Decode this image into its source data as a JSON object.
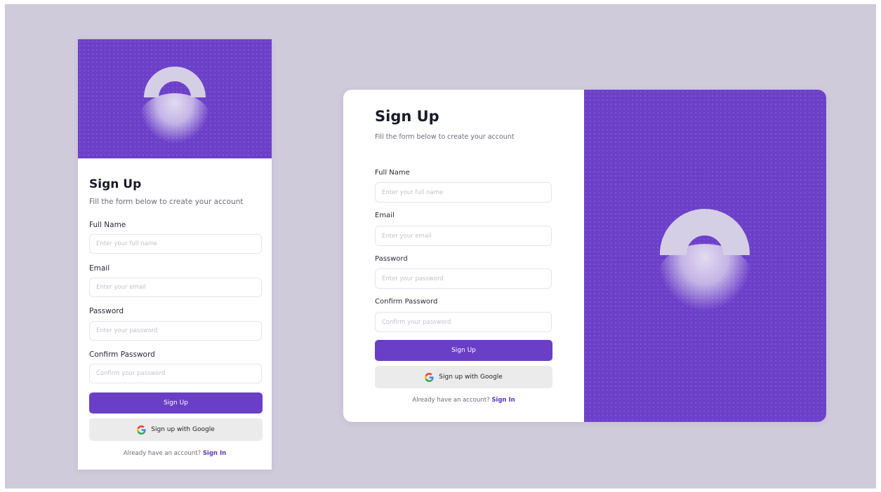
{
  "form": {
    "title": "Sign Up",
    "subtitle": "Fill the form below to create your account",
    "fields": [
      {
        "label": "Full Name",
        "placeholder": "Enter your full name"
      },
      {
        "label": "Email",
        "placeholder": "Enter your email"
      },
      {
        "label": "Password",
        "placeholder": "Enter your password"
      },
      {
        "label": "Confirm Password",
        "placeholder": "Confirm your password"
      }
    ],
    "submit_label": "Sign Up",
    "google_label": "Sign up with Google",
    "footer_text": "Already have an account?",
    "footer_link": "Sign In"
  },
  "colors": {
    "background": "#cfcbdb",
    "brand_purple": "#6a3fc8",
    "link_purple": "#5b35c0",
    "google_button": "#ebebec"
  },
  "icons": {
    "google": "google-g-icon",
    "decoration": "half-ring-arc"
  }
}
